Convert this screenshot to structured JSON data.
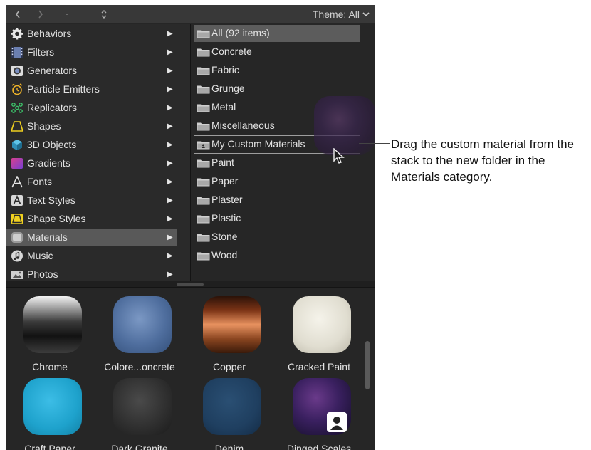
{
  "toolbar": {
    "back_icon": "chevron-left-icon",
    "forward_icon": "chevron-right-icon",
    "dash": "-",
    "sort_icon": "sort-updown-icon",
    "theme_label": "Theme: All",
    "theme_caret": "chevron-down-icon"
  },
  "categories": [
    {
      "label": "Behaviors",
      "icon": "gear-icon"
    },
    {
      "label": "Filters",
      "icon": "filmstrip-icon"
    },
    {
      "label": "Generators",
      "icon": "generator-icon"
    },
    {
      "label": "Particle Emitters",
      "icon": "alarm-clock-icon"
    },
    {
      "label": "Replicators",
      "icon": "replicator-dots-icon"
    },
    {
      "label": "Shapes",
      "icon": "shape-trapezoid-icon"
    },
    {
      "label": "3D Objects",
      "icon": "cube-icon"
    },
    {
      "label": "Gradients",
      "icon": "gradient-icon"
    },
    {
      "label": "Fonts",
      "icon": "font-a-icon"
    },
    {
      "label": "Text Styles",
      "icon": "text-style-icon"
    },
    {
      "label": "Shape Styles",
      "icon": "shape-style-icon"
    },
    {
      "label": "Materials",
      "icon": "materials-icon",
      "selected": true
    },
    {
      "label": "Music",
      "icon": "music-note-icon"
    },
    {
      "label": "Photos",
      "icon": "photo-icon"
    }
  ],
  "folders": [
    {
      "label": "All (92 items)",
      "selected": true
    },
    {
      "label": "Concrete"
    },
    {
      "label": "Fabric"
    },
    {
      "label": "Grunge"
    },
    {
      "label": "Metal"
    },
    {
      "label": "Miscellaneous"
    },
    {
      "label": "My Custom Materials",
      "highlight": true
    },
    {
      "label": "Paint"
    },
    {
      "label": "Paper"
    },
    {
      "label": "Plaster"
    },
    {
      "label": "Plastic"
    },
    {
      "label": "Stone"
    },
    {
      "label": "Wood"
    }
  ],
  "thumbnails": [
    {
      "label": "Chrome"
    },
    {
      "label": "Colore...oncrete"
    },
    {
      "label": "Copper"
    },
    {
      "label": "Cracked Paint"
    },
    {
      "label": "Craft Paper"
    },
    {
      "label": "Dark Granite"
    },
    {
      "label": "Denim"
    },
    {
      "label": "Dinged Scales"
    }
  ],
  "callout": "Drag the custom material from the stack to the new folder in the Materials category.",
  "colors": {
    "panel_bg": "#262626",
    "selection": "#595959",
    "text": "#e2e2e2"
  }
}
